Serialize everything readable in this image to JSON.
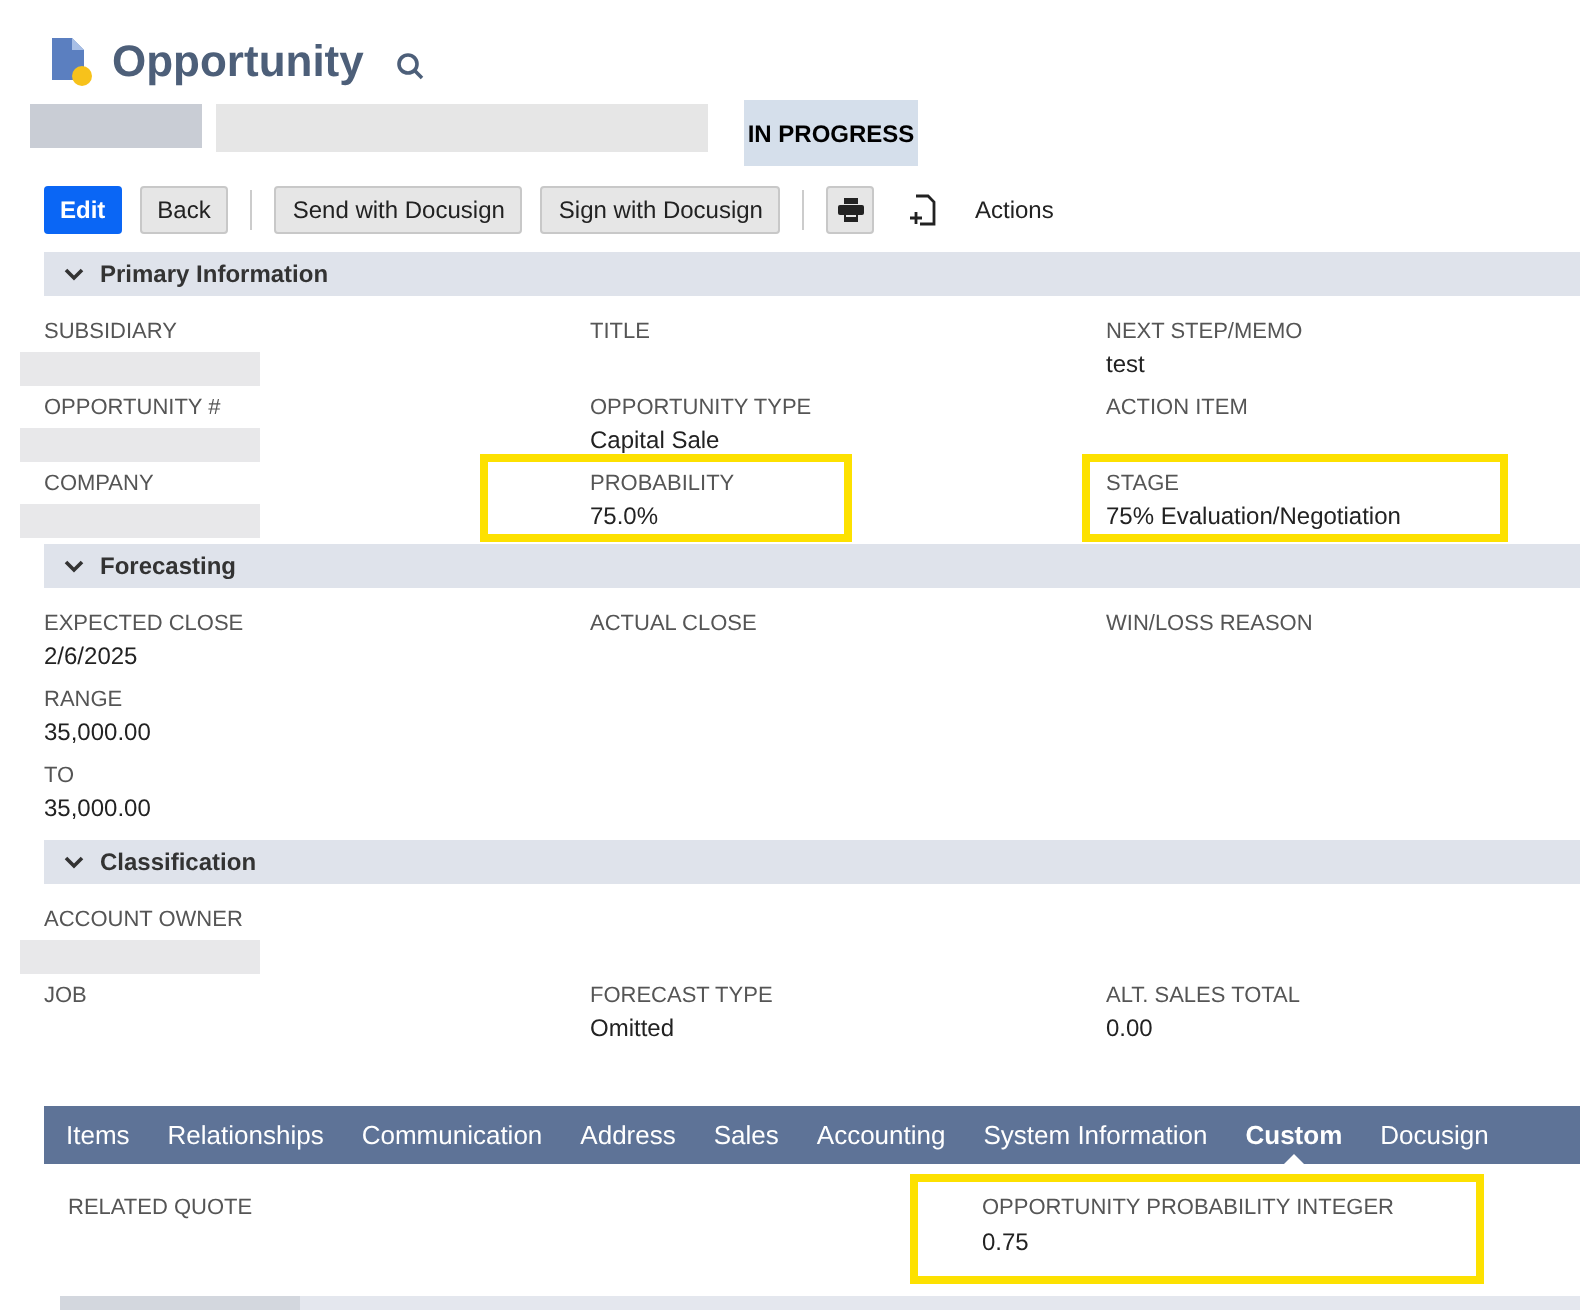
{
  "header": {
    "title": "Opportunity",
    "status": "IN PROGRESS"
  },
  "toolbar": {
    "buttons": [
      {
        "label": "Edit",
        "kind": "primary"
      },
      {
        "label": "Back",
        "kind": "plain"
      },
      {
        "kind": "divider"
      },
      {
        "label": "Send with Docusign",
        "kind": "plain"
      },
      {
        "label": "Sign with Docusign",
        "kind": "plain"
      },
      {
        "kind": "divider"
      },
      {
        "kind": "print"
      }
    ],
    "actions": "Actions"
  },
  "sections": [
    {
      "title": "Primary Information",
      "expanded": true,
      "rows": [
        {
          "left": {
            "label": "SUBSIDIARY",
            "redacted": true
          },
          "middle": {
            "label": "TITLE"
          },
          "right": {
            "label": "NEXT STEP/MEMO",
            "value": "test"
          }
        },
        {
          "left": {
            "label": "OPPORTUNITY #",
            "redacted": true
          },
          "middle": {
            "label": "OPPORTUNITY TYPE",
            "value": "Capital Sale"
          },
          "right": {
            "label": "ACTION ITEM"
          }
        },
        {
          "left": {
            "label": "COMPANY",
            "redacted": true
          },
          "middle": {
            "label": "PROBABILITY",
            "value": "75.0%",
            "highlighted": true
          },
          "right": {
            "label": "STAGE",
            "value": "75% Evaluation/Negotiation",
            "highlighted": true
          }
        }
      ]
    },
    {
      "title": "Forecasting",
      "expanded": true,
      "rows": [
        {
          "left": {
            "label": "EXPECTED CLOSE",
            "value": "2/6/2025"
          },
          "middle": {
            "label": "ACTUAL CLOSE"
          },
          "right": {
            "label": "WIN/LOSS REASON"
          }
        },
        {
          "left": {
            "label": "RANGE",
            "value": "35,000.00"
          }
        },
        {
          "left": {
            "label": "TO",
            "value": "35,000.00"
          }
        }
      ]
    },
    {
      "title": "Classification",
      "expanded": true,
      "rows": [
        {
          "left": {
            "label": "ACCOUNT OWNER",
            "redacted": true
          }
        },
        {
          "left": {
            "label": "JOB"
          },
          "middle": {
            "label": "FORECAST TYPE",
            "value": "Omitted"
          },
          "right": {
            "label": "ALT. SALES TOTAL",
            "value": "0.00"
          }
        }
      ]
    }
  ],
  "tabs": [
    {
      "label": "Items",
      "selected": false
    },
    {
      "label": "Relationships",
      "selected": false
    },
    {
      "label": "Communication",
      "selected": false
    },
    {
      "label": "Address",
      "selected": false
    },
    {
      "label": "Sales",
      "selected": false
    },
    {
      "label": "Accounting",
      "selected": false
    },
    {
      "label": "System Information",
      "selected": false
    },
    {
      "label": "Custom",
      "selected": true
    },
    {
      "label": "Docusign",
      "selected": false
    }
  ],
  "tab_content": {
    "left": {
      "label": "RELATED QUOTE"
    },
    "right": {
      "label": "OPPORTUNITY PROBABILITY INTEGER",
      "value": "0.75",
      "highlighted": true
    }
  }
}
